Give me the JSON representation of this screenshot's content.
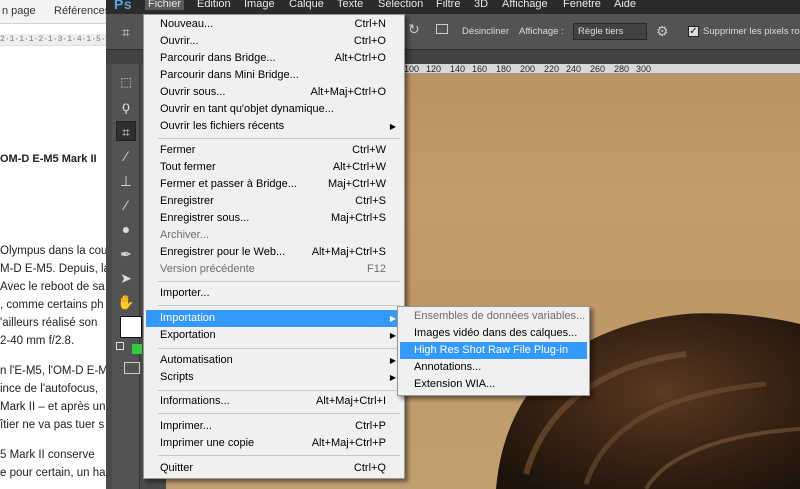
{
  "word": {
    "tabs": [
      "n page",
      "Références"
    ],
    "ruler": "2·1·1·1·2·1·3·1·4·1·5·1·6",
    "lines": [
      "OM-D E-M5 Mark II",
      "",
      "Olympus dans la cou",
      "M-D E-M5. Depuis, la",
      "Avec le reboot de sa",
      ", comme certains ph",
      "'ailleurs réalisé son",
      "2-40  mm f/2.8.",
      "n l'E-M5, l'OM-D E-M",
      "ince de l'autofocus,",
      "Mark II – et après un",
      "îtier ne va pas tuer s",
      "5 Mark II conserve",
      "e pour certain, un ha"
    ]
  },
  "photoshop": {
    "logo": "Ps",
    "menubar": [
      "Fichier",
      "Edition",
      "Image",
      "Calque",
      "Texte",
      "Sélection",
      "Filtre",
      "3D",
      "Affichage",
      "Fenêtre",
      "Aide"
    ],
    "options": {
      "straighten": "Désincliner",
      "display_label": "Affichage :",
      "display_value": "Règle tiers",
      "delete_pixels": "Supprimer les pixels rog"
    },
    "ruler_numbers": [
      "100",
      "120",
      "140",
      "160",
      "180",
      "200",
      "220",
      "240",
      "260",
      "280",
      "300"
    ]
  },
  "file_menu": {
    "items": [
      {
        "label": "Nouveau...",
        "shortcut": "Ctrl+N"
      },
      {
        "label": "Ouvrir...",
        "shortcut": "Ctrl+O"
      },
      {
        "label": "Parcourir dans Bridge...",
        "shortcut": "Alt+Ctrl+O"
      },
      {
        "label": "Parcourir dans Mini Bridge...",
        "shortcut": ""
      },
      {
        "label": "Ouvrir sous...",
        "shortcut": "Alt+Maj+Ctrl+O"
      },
      {
        "label": "Ouvrir en tant qu'objet dynamique...",
        "shortcut": ""
      },
      {
        "label": "Ouvrir les fichiers récents",
        "shortcut": ""
      },
      {
        "label": "Fermer",
        "shortcut": "Ctrl+W"
      },
      {
        "label": "Tout fermer",
        "shortcut": "Alt+Ctrl+W"
      },
      {
        "label": "Fermer et passer à Bridge...",
        "shortcut": "Maj+Ctrl+W"
      },
      {
        "label": "Enregistrer",
        "shortcut": "Ctrl+S"
      },
      {
        "label": "Enregistrer sous...",
        "shortcut": "Maj+Ctrl+S"
      },
      {
        "label": "Archiver...",
        "shortcut": ""
      },
      {
        "label": "Enregistrer pour le Web...",
        "shortcut": "Alt+Maj+Ctrl+S"
      },
      {
        "label": "Version précédente",
        "shortcut": "F12"
      },
      {
        "label": "Importer...",
        "shortcut": ""
      },
      {
        "label": "Importation",
        "shortcut": ""
      },
      {
        "label": "Exportation",
        "shortcut": ""
      },
      {
        "label": "Automatisation",
        "shortcut": ""
      },
      {
        "label": "Scripts",
        "shortcut": ""
      },
      {
        "label": "Informations...",
        "shortcut": "Alt+Maj+Ctrl+I"
      },
      {
        "label": "Imprimer...",
        "shortcut": "Ctrl+P"
      },
      {
        "label": "Imprimer une copie",
        "shortcut": "Alt+Maj+Ctrl+P"
      },
      {
        "label": "Quitter",
        "shortcut": "Ctrl+Q"
      }
    ]
  },
  "import_submenu": {
    "items": [
      {
        "label": "Ensembles de données variables..."
      },
      {
        "label": "Images vidéo dans des calques..."
      },
      {
        "label": "High Res Shot Raw File Plug-in"
      },
      {
        "label": "Annotations..."
      },
      {
        "label": "Extension WIA..."
      }
    ]
  },
  "colors": {
    "highlight": "#3399ff",
    "menu_bg": "#f0f0f0",
    "ps_dark": "#2b2b2b",
    "logo": "#5ba3df"
  }
}
